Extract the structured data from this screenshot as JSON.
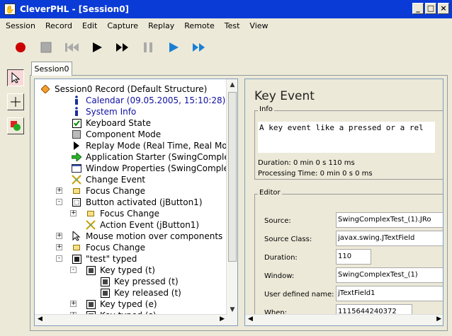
{
  "window": {
    "icon": "app-hand-icon",
    "title": "CleverPHL - [Session0]"
  },
  "menu": [
    "Session",
    "Record",
    "Edit",
    "Capture",
    "Replay",
    "Remote",
    "Test",
    "View"
  ],
  "tab_label": "Session0",
  "tree": [
    {
      "label": "Session0 Record (Default Structure)",
      "icon": "session-diamond-icon"
    },
    {
      "label": "Calendar (09.05.2005, 15:10:28)",
      "icon": "info-icon"
    },
    {
      "label": "System Info",
      "icon": "info-icon"
    },
    {
      "label": "Keyboard State",
      "icon": "checkbox-icon"
    },
    {
      "label": "Component Mode",
      "icon": "gray-square-icon"
    },
    {
      "label": "Replay Mode (Real Time, Real Mo",
      "icon": "play-triangle-icon"
    },
    {
      "label": "Application Starter (SwingComplex",
      "icon": "green-arrow-icon"
    },
    {
      "label": "Window Properties (SwingComplex",
      "icon": "window-icon"
    },
    {
      "label": "Change Event",
      "icon": "change-event-icon"
    },
    {
      "label": "Focus Change",
      "icon": "focus-icon"
    },
    {
      "label": "Button activated (jButton1)",
      "icon": "button-icon"
    },
    {
      "label": "Focus Change",
      "icon": "focus-icon"
    },
    {
      "label": "Action Event (jButton1)",
      "icon": "action-icon"
    },
    {
      "label": "Mouse motion over components",
      "icon": "mouse-icon"
    },
    {
      "label": "Focus Change",
      "icon": "focus-icon"
    },
    {
      "label": "\"test\" typed",
      "icon": "typed-icon"
    },
    {
      "label": "Key typed (t)",
      "icon": "key-icon"
    },
    {
      "label": "Key pressed (t)",
      "icon": "key-icon"
    },
    {
      "label": "Key released (t)",
      "icon": "key-icon"
    },
    {
      "label": "Key typed (e)",
      "icon": "key-icon"
    },
    {
      "label": "Key typed (s)",
      "icon": "key-icon"
    }
  ],
  "detail": {
    "title": "Key Event",
    "info_label": "Info",
    "info_text": "A key event like a pressed or a rel",
    "duration_text": "Duration: 0 min 0 s 110 ms",
    "processing_text": "Processing Time: 0 min 0 s 0 ms",
    "editor_label": "Editor",
    "fields": [
      {
        "label": "Source:",
        "value": "SwingComplexTest_(1).JRo"
      },
      {
        "label": "Source Class:",
        "value": "javax.swing.JTextField"
      },
      {
        "label": "Duration:",
        "value": "110"
      },
      {
        "label": "Window:",
        "value": "SwingComplexTest_(1)"
      },
      {
        "label": "User defined name:",
        "value": "jTextField1"
      },
      {
        "label": "When:",
        "value": "1115644240372"
      }
    ]
  },
  "colors": {
    "title_bar": "#0b3bd6",
    "record_red": "#cc0000",
    "play_blue": "#1a7fd4",
    "tree_link_blue": "#1010a0"
  }
}
